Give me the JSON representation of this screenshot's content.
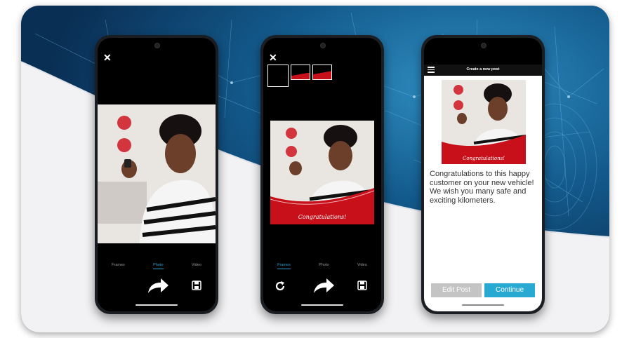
{
  "screen1": {
    "close_icon": "close-icon",
    "tabs": [
      {
        "label": "Frames"
      },
      {
        "label": "Photo"
      },
      {
        "label": "Video"
      }
    ],
    "active_tab": "Photo"
  },
  "screen2": {
    "close_icon": "close-icon",
    "banner_text": "Congratulations!",
    "tabs": [
      {
        "label": "Frames"
      },
      {
        "label": "Photo"
      },
      {
        "label": "Video"
      }
    ],
    "active_tab": "Frames"
  },
  "screen3": {
    "title": "Create a new post",
    "banner_text": "Congratulations!",
    "caption": "Congratulations to this happy customer on your new vehicle! We wish you many safe and exciting kilometers.",
    "edit_button": "Edit Post",
    "continue_button": "Continue"
  },
  "colors": {
    "accent": "#27a9d2",
    "frame_red": "#c8101a",
    "disabled": "#c4c4c4"
  }
}
